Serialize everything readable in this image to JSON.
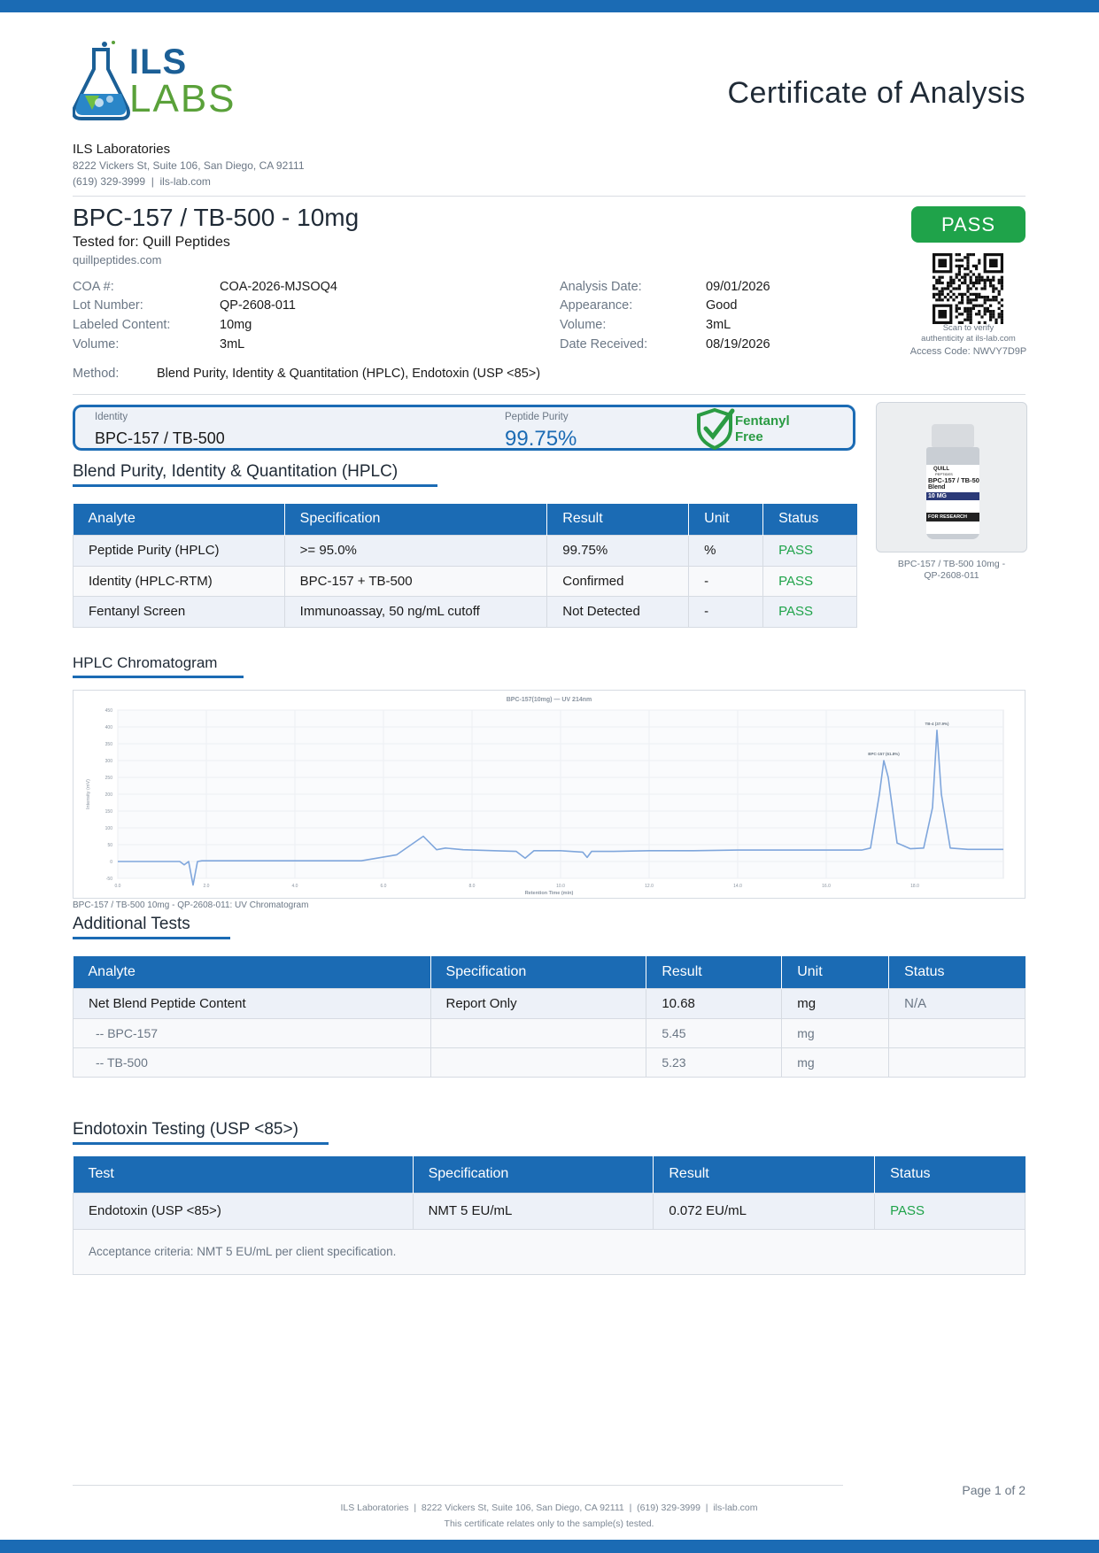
{
  "lab": {
    "logo_top": "ILS",
    "logo_bottom": "LABS",
    "name": "ILS Laboratories",
    "address": "8222 Vickers St, Suite 106, San Diego, CA 92111",
    "contact": "(619) 329-3999  |  ils-lab.com"
  },
  "doc_title": "Certificate of Analysis",
  "product": {
    "name": "BPC-157 / TB-500 - 10mg",
    "tested_for": "Tested for: Quill Peptides",
    "client_site": "quillpeptides.com"
  },
  "status_badge": "PASS",
  "qr": {
    "caption1": "Scan to verify",
    "caption2": "authenticity at ils-lab.com",
    "access_code": "Access Code: NWVY7D9P"
  },
  "details_left": [
    {
      "label": "COA #:",
      "value": "COA-2026-MJSOQ4"
    },
    {
      "label": "Lot Number:",
      "value": "QP-2608-011"
    },
    {
      "label": "Labeled Content:",
      "value": "10mg"
    },
    {
      "label": "Volume:",
      "value": "3mL"
    }
  ],
  "details_right": [
    {
      "label": "Analysis Date:",
      "value": "09/01/2026"
    },
    {
      "label": "Appearance:",
      "value": "Good"
    },
    {
      "label": "Volume:",
      "value": "3mL"
    },
    {
      "label": "Date Received:",
      "value": "08/19/2026"
    }
  ],
  "method": {
    "label": "Method:",
    "value": "Blend Purity, Identity & Quantitation (HPLC), Endotoxin (USP <85>)"
  },
  "summary": {
    "identity_label": "Identity",
    "identity_value": "BPC-157 / TB-500",
    "purity_label": "Peptide Purity",
    "purity_value": "99.75%",
    "fentanyl_line1": "Fentanyl",
    "fentanyl_line2": "Free"
  },
  "vial": {
    "caption1": "BPC-157 / TB-500 10mg -",
    "caption2": "QP-2608-011",
    "brand": "QUILL",
    "brand_sub": "PEPTIDES",
    "label_line1": "BPC-157 / TB-500",
    "label_line2": "Blend",
    "dose": "10 MG",
    "band": "FOR RESEARCH"
  },
  "hplc_section": {
    "title": "Blend Purity, Identity & Quantitation (HPLC)",
    "headers": [
      "Analyte",
      "Specification",
      "Result",
      "Unit",
      "Status"
    ],
    "rows": [
      [
        "Peptide Purity (HPLC)",
        ">= 95.0%",
        "99.75%",
        "%",
        "PASS"
      ],
      [
        "Identity (HPLC-RTM)",
        "BPC-157 + TB-500",
        "Confirmed",
        "-",
        "PASS"
      ],
      [
        "Fentanyl Screen",
        "Immunoassay, 50 ng/mL cutoff",
        "Not Detected",
        "-",
        "PASS"
      ]
    ]
  },
  "chromatogram": {
    "section_title": "HPLC Chromatogram",
    "caption": "BPC-157 / TB-500 10mg - QP-2608-011: UV Chromatogram"
  },
  "chart_data": {
    "type": "line",
    "title": "BPC-157(10mg) — UV 214nm",
    "xlabel": "Retention Time (min)",
    "ylabel": "Intensity (mV)",
    "xlim": [
      0,
      20
    ],
    "ylim": [
      -50,
      450
    ],
    "x_ticks": [
      0,
      2,
      4,
      6,
      8,
      10,
      12,
      14,
      16,
      18
    ],
    "y_ticks": [
      -50,
      0,
      50,
      100,
      150,
      200,
      250,
      300,
      350,
      400,
      450
    ],
    "grid": true,
    "peaks": [
      {
        "label": "BPC-157 (61.8%)",
        "x": 17.3,
        "y": 300
      },
      {
        "label": "TB-4 (37.9%)",
        "x": 18.5,
        "y": 390
      }
    ],
    "series": [
      {
        "x": [
          0,
          1,
          1.4,
          1.5,
          1.6,
          1.7,
          1.8,
          1.9,
          2.0,
          5.5,
          6.3,
          6.9,
          7.2,
          7.4,
          7.8,
          8.5,
          9.0,
          9.2,
          9.4,
          10.0,
          10.5,
          10.6,
          10.7,
          11.2,
          12,
          13,
          14,
          15,
          16,
          16.8,
          17.0,
          17.2,
          17.3,
          17.4,
          17.6,
          17.9,
          18.2,
          18.4,
          18.5,
          18.6,
          18.8,
          19.2,
          20
        ],
        "y": [
          0,
          0,
          0,
          -10,
          0,
          -70,
          0,
          2,
          2,
          2,
          20,
          75,
          35,
          40,
          35,
          32,
          30,
          10,
          32,
          32,
          28,
          12,
          30,
          30,
          32,
          32,
          34,
          34,
          34,
          34,
          40,
          200,
          300,
          250,
          55,
          38,
          40,
          160,
          390,
          200,
          40,
          36,
          36
        ]
      }
    ]
  },
  "additional": {
    "title": "Additional Tests",
    "headers": [
      "Analyte",
      "Specification",
      "Result",
      "Unit",
      "Status"
    ],
    "rows": [
      [
        "Net Blend Peptide Content",
        "Report Only",
        "10.68",
        "mg",
        "N/A"
      ],
      [
        "-- BPC-157",
        "",
        "5.45",
        "mg",
        ""
      ],
      [
        "-- TB-500",
        "",
        "5.23",
        "mg",
        ""
      ]
    ]
  },
  "endotoxin": {
    "title": "Endotoxin Testing (USP <85>)",
    "headers": [
      "Test",
      "Specification",
      "Result",
      "Status"
    ],
    "rows": [
      [
        "Endotoxin (USP <85>)",
        "NMT 5 EU/mL",
        "0.072 EU/mL",
        "PASS"
      ]
    ],
    "note": "Acceptance criteria: NMT 5 EU/mL per client specification."
  },
  "footer": {
    "page": "Page 1 of 2",
    "line1": "ILS Laboratories  |  8222 Vickers St, Suite 106, San Diego, CA 92111  |  (619) 329-3999  |  ils-lab.com",
    "line2": "This certificate relates only to the sample(s) tested."
  },
  "colors": {
    "accent": "#1b6bb4",
    "pass": "#1fa34a",
    "logo_blue": "#1b6bb4",
    "logo_green": "#5aa13a"
  }
}
